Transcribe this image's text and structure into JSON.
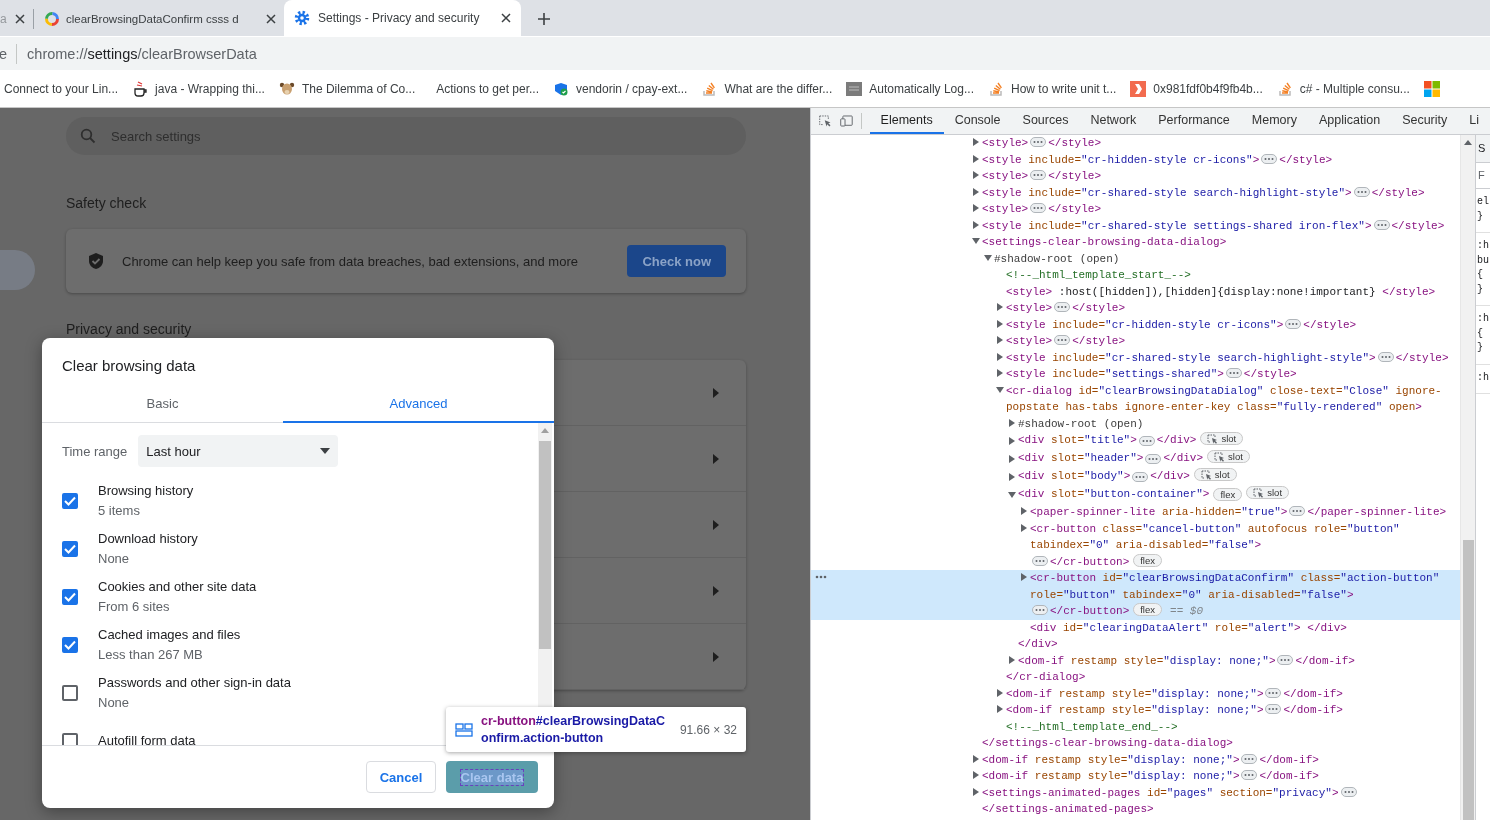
{
  "browser": {
    "tabs": [
      {
        "title": "a",
        "kind": "plain",
        "selected": false
      },
      {
        "title": "clearBrowsingDataConfirm csss d",
        "kind": "google",
        "selected": false
      },
      {
        "title": "Settings - Privacy and security",
        "kind": "settings",
        "selected": true
      }
    ],
    "address": {
      "prefix": "e",
      "scheme": "chrome://",
      "host": "settings",
      "path": "/clearBrowserData"
    },
    "bookmarks": [
      {
        "title": "Connect to your Lin...",
        "kind": "plain"
      },
      {
        "title": "java - Wrapping thi...",
        "kind": "cup"
      },
      {
        "title": "The Dilemma of Co...",
        "kind": "animal"
      },
      {
        "title": "Actions to get per...",
        "kind": "blank"
      },
      {
        "title": "vendorin / cpay-ext...",
        "kind": "badge"
      },
      {
        "title": "What are the differ...",
        "kind": "stack"
      },
      {
        "title": "Automatically Log...",
        "kind": "square"
      },
      {
        "title": "How to write unit t...",
        "kind": "stack"
      },
      {
        "title": "0x981fdf0b4f9fb4b...",
        "kind": "tile"
      },
      {
        "title": "c# - Multiple consu...",
        "kind": "stack"
      },
      {
        "kind": "windows"
      }
    ]
  },
  "settings": {
    "search": {
      "placeholder": "Search settings"
    },
    "safety_check": {
      "heading": "Safety check",
      "text": "Chrome can help keep you safe from data breaches, bad extensions, and more",
      "button": "Check now"
    },
    "privacy": {
      "heading": "Privacy and security",
      "rows": [
        {
          "kind": "link-row"
        },
        {
          "kind": "link-row"
        },
        {
          "kind": "link-row"
        },
        {
          "kind": "link-row"
        },
        {
          "kind": "link-row"
        }
      ]
    }
  },
  "dialog": {
    "title": "Clear browsing data",
    "tabs": [
      {
        "label": "Basic",
        "selected": false
      },
      {
        "label": "Advanced",
        "selected": true
      }
    ],
    "time_range": {
      "label": "Time range",
      "value": "Last hour"
    },
    "items": [
      {
        "label": "Browsing history",
        "detail": "5 items",
        "checked": true
      },
      {
        "label": "Download history",
        "detail": "None",
        "checked": true
      },
      {
        "label": "Cookies and other site data",
        "detail": "From 6 sites",
        "checked": true
      },
      {
        "label": "Cached images and files",
        "detail": "Less than 267 MB",
        "checked": true
      },
      {
        "label": "Passwords and other sign-in data",
        "detail": "None",
        "checked": false
      },
      {
        "label": "Autofill form data",
        "checked": false
      }
    ],
    "buttons": [
      {
        "label": "Cancel",
        "kind": "cancel",
        "inspected": false
      },
      {
        "label": "Clear data",
        "kind": "action",
        "inspected": true
      }
    ]
  },
  "inspect_tooltip": {
    "tag": "cr-button",
    "selector": "#clearBrowsingDataConfirm.action-button",
    "size": "91.66 × 32"
  },
  "devtools": {
    "tabs": [
      {
        "label": "Elements",
        "selected": true
      },
      {
        "label": "Console",
        "selected": false
      },
      {
        "label": "Sources",
        "selected": false
      },
      {
        "label": "Network",
        "selected": false
      },
      {
        "label": "Performance",
        "selected": false
      },
      {
        "label": "Memory",
        "selected": false
      },
      {
        "label": "Application",
        "selected": false
      },
      {
        "label": "Security",
        "selected": false
      },
      {
        "label": "Li",
        "selected": false
      }
    ],
    "dom_tree": [
      {
        "kind": "element",
        "open": "<style>",
        "close": "</style>",
        "expanded": false,
        "selected": false
      },
      {
        "kind": "element",
        "open": "<style include=\"cr-hidden-style cr-icons\">",
        "close": "</style>",
        "expanded": false,
        "selected": false
      },
      {
        "kind": "element",
        "open": "<style>",
        "close": "</style>",
        "expanded": false,
        "selected": false
      },
      {
        "kind": "element",
        "open": "<style include=\"cr-shared-style search-highlight-style\">",
        "close": "</style>",
        "expanded": false,
        "selected": false
      },
      {
        "kind": "element",
        "open": "<style>",
        "close": "</style>",
        "expanded": false,
        "selected": false
      },
      {
        "kind": "element",
        "open": "<style include=\"cr-shared-style settings-shared iron-flex\">",
        "close": "</style>",
        "expanded": false,
        "selected": false
      },
      {
        "kind": "element",
        "open": "<settings-clear-browsing-data-dialog>",
        "close": "</settings-clear-browsing-data-dialog>",
        "expanded": true,
        "selected": false,
        "children": [
          {
            "kind": "shadow-root",
            "text": "#shadow-root (open)",
            "expanded": true,
            "selected": false,
            "children": [
              {
                "kind": "comment",
                "text": "<!--_html_template_start_-->",
                "selected": false
              },
              {
                "kind": "leaf",
                "text": "<style> :host([hidden]),[hidden]{display:none!important} </style>",
                "selected": false
              },
              {
                "kind": "element",
                "open": "<style>",
                "close": "</style>",
                "expanded": false,
                "selected": false
              },
              {
                "kind": "element",
                "open": "<style include=\"cr-hidden-style cr-icons\">",
                "close": "</style>",
                "expanded": false,
                "selected": false
              },
              {
                "kind": "element",
                "open": "<style>",
                "close": "</style>",
                "expanded": false,
                "selected": false
              },
              {
                "kind": "element",
                "open": "<style include=\"cr-shared-style search-highlight-style\">",
                "close": "</style>",
                "expanded": false,
                "selected": false
              },
              {
                "kind": "element",
                "open": "<style include=\"settings-shared\">",
                "close": "</style>",
                "expanded": false,
                "selected": false
              },
              {
                "kind": "element",
                "open": "<cr-dialog id=\"clearBrowsingDataDialog\" close-text=\"Close\" ignore-popstate has-tabs ignore-enter-key class=\"fully-rendered\" open>",
                "close": "</cr-dialog>",
                "expanded": true,
                "selected": false,
                "children": [
                  {
                    "kind": "shadow-root",
                    "text": "#shadow-root (open)",
                    "expanded": false,
                    "selected": false
                  },
                  {
                    "kind": "element",
                    "open": "<div slot=\"title\">",
                    "close": "</div>",
                    "expanded": false,
                    "selected": false,
                    "badges": [
                      {
                        "kind": "slot",
                        "label": "slot"
                      }
                    ]
                  },
                  {
                    "kind": "element",
                    "open": "<div slot=\"header\">",
                    "close": "</div>",
                    "expanded": false,
                    "selected": false,
                    "badges": [
                      {
                        "kind": "slot",
                        "label": "slot"
                      }
                    ]
                  },
                  {
                    "kind": "element",
                    "open": "<div slot=\"body\">",
                    "close": "</div>",
                    "expanded": false,
                    "selected": false,
                    "badges": [
                      {
                        "kind": "slot",
                        "label": "slot"
                      }
                    ]
                  },
                  {
                    "kind": "element",
                    "open": "<div slot=\"button-container\">",
                    "close": "</div>",
                    "expanded": true,
                    "selected": false,
                    "badges": [
                      {
                        "kind": "flex",
                        "label": "flex"
                      },
                      {
                        "kind": "slot",
                        "label": "slot"
                      }
                    ],
                    "children": [
                      {
                        "kind": "element",
                        "open": "<paper-spinner-lite aria-hidden=\"true\">",
                        "close": "</paper-spinner-lite>",
                        "expanded": false,
                        "selected": false
                      },
                      {
                        "kind": "element",
                        "open": "<cr-button class=\"cancel-button\" autofocus role=\"button\" tabindex=\"0\" aria-disabled=\"false\">",
                        "close": "</cr-button>",
                        "expanded": false,
                        "selected": false,
                        "badges": [
                          {
                            "kind": "flex",
                            "label": "flex"
                          }
                        ]
                      },
                      {
                        "kind": "element",
                        "open": "<cr-button id=\"clearBrowsingDataConfirm\" class=\"action-button\" role=\"button\" tabindex=\"0\" aria-disabled=\"false\">",
                        "close": "</cr-button>",
                        "expanded": false,
                        "selected": true,
                        "badges": [
                          {
                            "kind": "flex",
                            "label": "flex"
                          }
                        ],
                        "console_ref": "== $0"
                      },
                      {
                        "kind": "leaf",
                        "text": "<div id=\"clearingDataAlert\" role=\"alert\"> </div>",
                        "selected": false
                      }
                    ]
                  },
                  {
                    "kind": "element",
                    "open": "<dom-if restamp style=\"display: none;\">",
                    "close": "</dom-if>",
                    "expanded": false,
                    "selected": false
                  }
                ]
              },
              {
                "kind": "element",
                "open": "<dom-if restamp style=\"display: none;\">",
                "close": "</dom-if>",
                "expanded": false,
                "selected": false
              },
              {
                "kind": "element",
                "open": "<dom-if restamp style=\"display: none;\">",
                "close": "</dom-if>",
                "expanded": false,
                "selected": false
              },
              {
                "kind": "comment",
                "text": "<!--_html_template_end_-->",
                "selected": false
              }
            ]
          }
        ]
      },
      {
        "kind": "element",
        "open": "<dom-if restamp style=\"display: none;\">",
        "close": "</dom-if>",
        "expanded": false,
        "selected": false
      },
      {
        "kind": "element",
        "open": "<dom-if restamp style=\"display: none;\">",
        "close": "</dom-if>",
        "expanded": false,
        "selected": false
      },
      {
        "kind": "element",
        "open": "<settings-animated-pages id=\"pages\" section=\"privacy\">",
        "close": "</settings-animated-pages>",
        "expanded": false,
        "selected": false
      }
    ],
    "styles_pane": {
      "tab": "S",
      "filter": "F",
      "rules": [
        [
          "el",
          "}"
        ],
        [
          ":h",
          "bu",
          "{",
          "}"
        ],
        [
          ":h",
          "{",
          "}"
        ],
        [
          ":h"
        ]
      ]
    }
  }
}
